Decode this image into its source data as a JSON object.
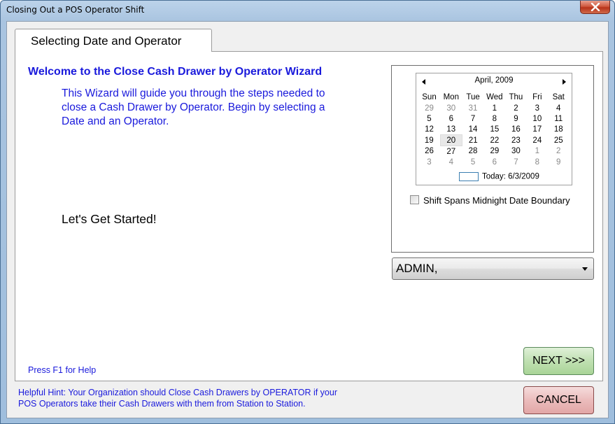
{
  "window": {
    "title": "Closing Out a POS Operator Shift"
  },
  "tab": {
    "label": "Selecting Date and Operator"
  },
  "wizard": {
    "heading": "Welcome to the Close Cash Drawer by Operator Wizard",
    "intro": "This Wizard will guide you through the steps needed to close a Cash Drawer by Operator.  Begin by selecting a Date and an Operator.",
    "start_text": "Let's Get Started!",
    "help_text": "Press F1 for Help"
  },
  "calendar": {
    "month_label": "April, 2009",
    "day_names": [
      "Sun",
      "Mon",
      "Tue",
      "Wed",
      "Thu",
      "Fri",
      "Sat"
    ],
    "weeks": [
      [
        "29",
        "30",
        "31",
        "1",
        "2",
        "3",
        "4"
      ],
      [
        "5",
        "6",
        "7",
        "8",
        "9",
        "10",
        "11"
      ],
      [
        "12",
        "13",
        "14",
        "15",
        "16",
        "17",
        "18"
      ],
      [
        "19",
        "20",
        "21",
        "22",
        "23",
        "24",
        "25"
      ],
      [
        "26",
        "27",
        "28",
        "29",
        "30",
        "1",
        "2"
      ],
      [
        "3",
        "4",
        "5",
        "6",
        "7",
        "8",
        "9"
      ]
    ],
    "selected_day": "20",
    "today_label": "Today: 6/3/2009"
  },
  "shift_checkbox": {
    "label": "Shift Spans Midnight Date Boundary",
    "checked": false
  },
  "operator_select": {
    "value": "ADMIN,"
  },
  "buttons": {
    "next": "NEXT >>>",
    "cancel": "CANCEL"
  },
  "hint": {
    "line1": "Helpful Hint:  Your Organization should Close Cash Drawers by OPERATOR if your",
    "line2": "POS Operators take their Cash Drawers with them from Station to Station."
  },
  "colors": {
    "accent_text": "#1a1adc",
    "next_button": "#c0e0b2",
    "cancel_button": "#ebbcbc"
  }
}
